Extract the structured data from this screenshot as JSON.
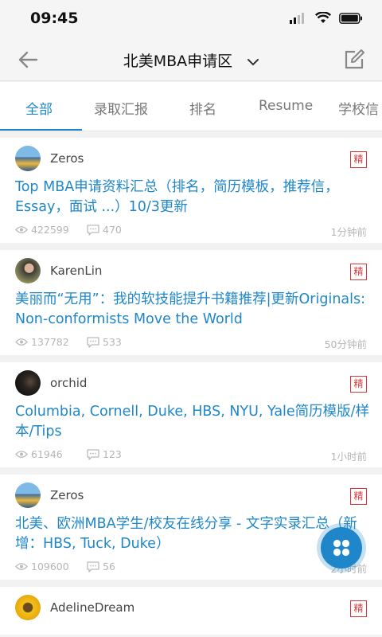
{
  "status": {
    "time": "09:45"
  },
  "nav": {
    "title": "北美MBA申请区"
  },
  "tabs": [
    {
      "label": "全部"
    },
    {
      "label": "录取汇报"
    },
    {
      "label": "排名"
    },
    {
      "label": "Resume"
    },
    {
      "label": "学校信"
    }
  ],
  "posts": [
    {
      "user": "Zeros",
      "badge": "精",
      "title": "Top MBA申请资料汇总（排名，简历模板，推荐信，Essay，面试 ...）10/3更新",
      "views": "422599",
      "comments": "470",
      "time": "1分钟前"
    },
    {
      "user": "KarenLin",
      "badge": "精",
      "title": "美丽而“无用”：我的软技能提升书籍推荐|更新Originals: Non-conformists Move the World",
      "views": "137782",
      "comments": "533",
      "time": "50分钟前"
    },
    {
      "user": "orchid",
      "badge": "精",
      "title": "Columbia, Cornell, Duke, HBS, NYU, Yale简历模版/样本/Tips",
      "views": "61946",
      "comments": "123",
      "time": "1小时前"
    },
    {
      "user": "Zeros",
      "badge": "精",
      "title": "北美、欧洲MBA学生/校友在线分享 - 文字实录汇总（新增：HBS, Tuck, Duke）",
      "views": "109600",
      "comments": "56",
      "time": "2小时前"
    },
    {
      "user": "AdelineDream",
      "badge": "精"
    }
  ],
  "colors": {
    "accent": "#1f87c9",
    "badge": "#d23a3a",
    "meta": "#b5b5b5"
  }
}
